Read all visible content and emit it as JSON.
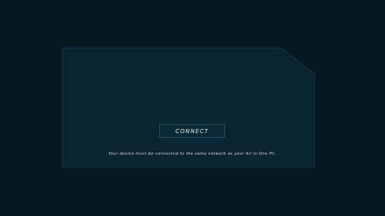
{
  "connect_panel": {
    "connect_label": "Connect",
    "hint_text": "Your device must be connected to the same network as your All in One PC."
  },
  "colors": {
    "background": "#061820",
    "panel_fill": "#0a2430",
    "panel_border": "#173845",
    "button_border": "#1d5466",
    "text": "#e8f4f8"
  }
}
